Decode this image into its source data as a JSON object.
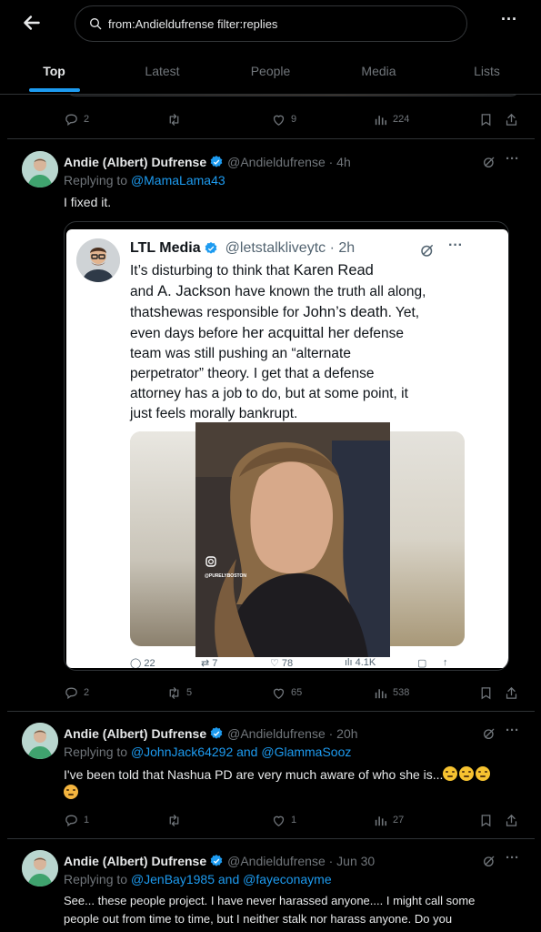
{
  "search": {
    "query": "from:Andieldufrense filter:replies"
  },
  "tabs": [
    {
      "label": "Top",
      "active": true
    },
    {
      "label": "Latest"
    },
    {
      "label": "People"
    },
    {
      "label": "Media"
    },
    {
      "label": "Lists"
    }
  ],
  "prev_tweet": {
    "replies": "2",
    "likes": "9",
    "views": "224"
  },
  "tweets": [
    {
      "name": "Andie (Albert) Dufrense",
      "handle": "@Andieldufrense · 4h",
      "replying_prefix": "Replying to ",
      "replying_to": "@MamaLama43",
      "text": "I fixed it.",
      "replies": "2",
      "retweets": "5",
      "likes": "65",
      "views": "538",
      "embedded": {
        "name": "LTL Media",
        "handle": "@letstalkliveytc · 2h",
        "line1_a": "It’s disturbing to think that ",
        "line1_b": "Karen Read",
        "line2_a": "and ",
        "line2_b": "A. Jackson",
        "line2_c": " have known the truth all along,",
        "line3_a": "that",
        "line3_b": "she",
        "line3_c": "was responsible for ",
        "line3_d": "John’s death",
        "line3_e": ". Yet,",
        "line4_a": "even days before ",
        "line4_b": "her acquittal her",
        "line4_c": " defense",
        "line5": "team was still pushing an “alternate",
        "line6": "perpetrator” theory. I get that a defense",
        "line7": "attorney has a job to do, but at some point, it",
        "line8": "just feels morally bankrupt.",
        "watermark": "@PURELYBOSTON",
        "replies": "22",
        "retweets": "7",
        "likes": "78",
        "views": "4.1K"
      }
    },
    {
      "name": "Andie (Albert) Dufrense",
      "handle": "@Andieldufrense · 20h",
      "replying_prefix": "Replying to ",
      "replying_to": "@JohnJack64292 and @GlammaSooz",
      "text": "I've been told that Nashua PD are very much aware of who she is...",
      "replies": "1",
      "retweets": "",
      "likes": "1",
      "views": "27"
    },
    {
      "name": "Andie (Albert) Dufrense",
      "handle": "@Andieldufrense · Jun 30",
      "replying_prefix": "Replying to ",
      "replying_to": "@JenBay1985 and @fayeconayme",
      "text_line1": "See... these people project. I have never harassed anyone.... I might call some",
      "text_line2": "people out from time to time, but I neither stalk  nor harass anyone. Do you"
    }
  ],
  "colors": {
    "accent": "#1d9bf0",
    "bg": "#000000",
    "muted": "#71767b",
    "text": "#e7e9ea",
    "divider": "#2f3336"
  }
}
